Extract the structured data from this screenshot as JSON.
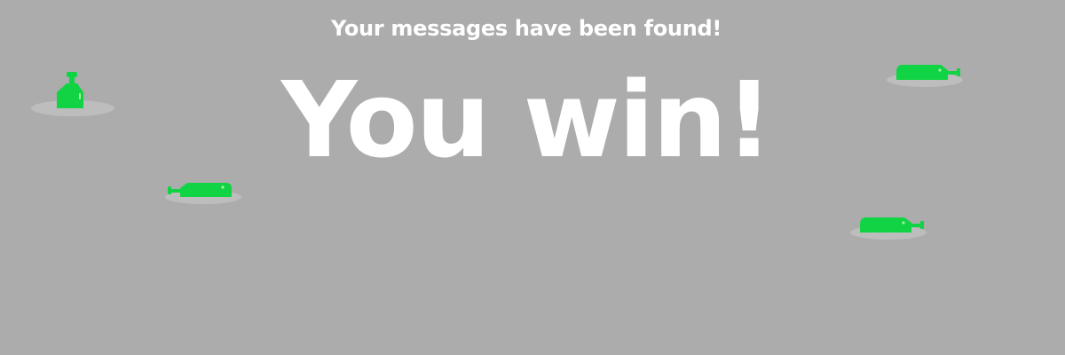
{
  "screen": {
    "background_color": "#acacac",
    "text_color": "#ffffff"
  },
  "message": {
    "subtitle": "Your messages have been found!",
    "headline": "You win!"
  },
  "bottles": {
    "color": "#10d444",
    "shadow_color": "#bdbdbd",
    "highlight_color": "#a8f0a0",
    "items": [
      {
        "name": "bottle-upright",
        "orientation": "upright"
      },
      {
        "name": "bottle-left",
        "orientation": "lying-left"
      },
      {
        "name": "bottle-top-right",
        "orientation": "lying-right"
      },
      {
        "name": "bottle-bottom-right",
        "orientation": "lying-right"
      }
    ]
  }
}
